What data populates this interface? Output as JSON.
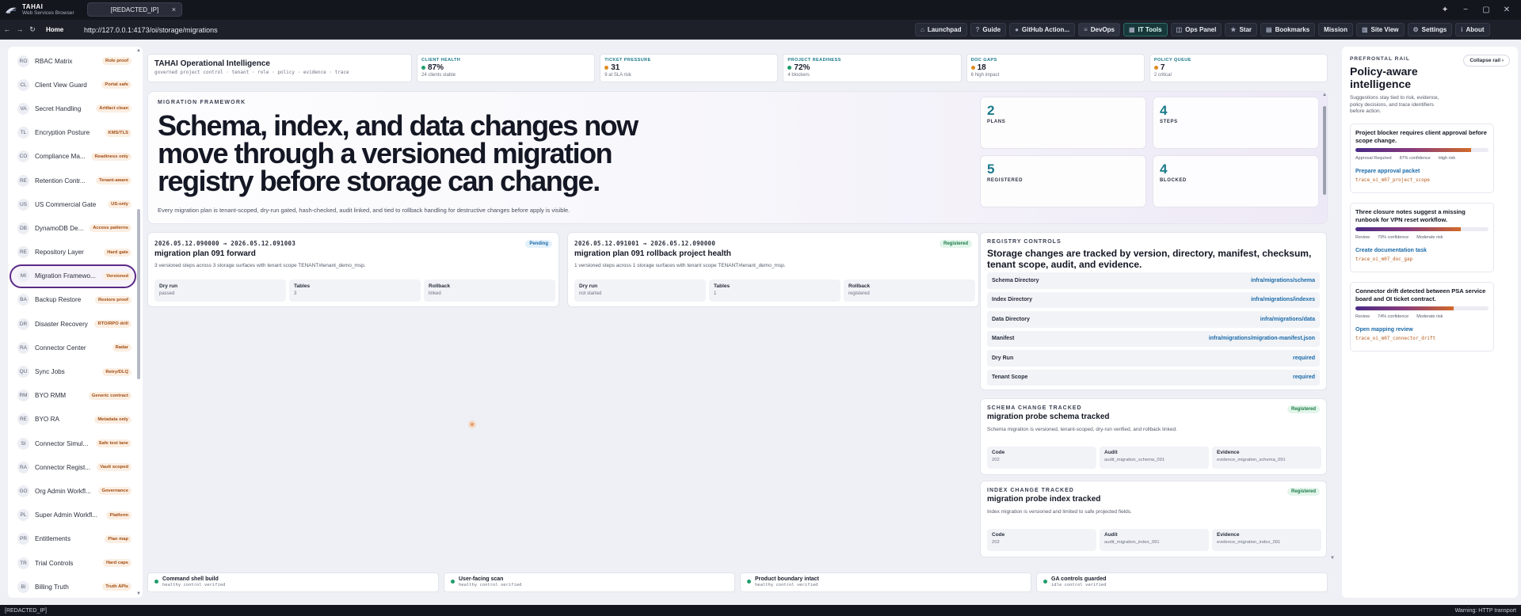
{
  "window": {
    "brand_name": "TAHAI",
    "brand_sub": "Web Services Browser",
    "tab_title": "[REDACTED_IP]",
    "tab_close": "×",
    "new_tab": "+",
    "minimize": "−",
    "maximize": "▢",
    "close": "✕"
  },
  "nav": {
    "back": "←",
    "forward": "→",
    "reload": "↻",
    "home": "Home",
    "url": "http://127.0.0.1:4173/oi/storage/migrations"
  },
  "toolbar": [
    {
      "icon": "⌂",
      "icon_name": "launchpad-icon",
      "label": "Launchpad"
    },
    {
      "icon": "?",
      "icon_name": "help-icon",
      "label": "Guide"
    },
    {
      "icon": "●",
      "icon_name": "github-icon",
      "label": "GitHub Action..."
    },
    {
      "icon": "≡",
      "icon_name": "devops-icon",
      "label": "DevOps"
    },
    {
      "icon": "▦",
      "icon_name": "tools-icon",
      "label": "IT Tools"
    },
    {
      "icon": "◫",
      "icon_name": "panel-icon",
      "label": "Ops Panel"
    },
    {
      "icon": "★",
      "icon_name": "star-icon",
      "label": "Star"
    },
    {
      "icon": "▤",
      "icon_name": "bookmark-icon",
      "label": "Bookmarks"
    },
    {
      "icon": "",
      "icon_name": "",
      "label": "Mission"
    },
    {
      "icon": "▥",
      "icon_name": "site-view-icon",
      "label": "Site View"
    },
    {
      "icon": "⚙",
      "icon_name": "gear-icon",
      "label": "Settings"
    },
    {
      "icon": "i",
      "icon_name": "info-icon",
      "label": "About"
    }
  ],
  "sidebar": {
    "items": [
      {
        "abbr": "RO",
        "label": "RBAC Matrix",
        "badge": "Role proof"
      },
      {
        "abbr": "CL",
        "label": "Client View Guard",
        "badge": "Portal safe"
      },
      {
        "abbr": "VA",
        "label": "Secret Handling",
        "badge": "Artifact clean"
      },
      {
        "abbr": "TL",
        "label": "Encryption Posture",
        "badge": "KMS/TLS"
      },
      {
        "abbr": "CO",
        "label": "Compliance Ma...",
        "badge": "Readiness only"
      },
      {
        "abbr": "RE",
        "label": "Retention Contr...",
        "badge": "Tenant-aware"
      },
      {
        "abbr": "US",
        "label": "US Commercial Gate",
        "badge": "US-only"
      },
      {
        "abbr": "DB",
        "label": "DynamoDB De...",
        "badge": "Access patterns"
      },
      {
        "abbr": "RE",
        "label": "Repository Layer",
        "badge": "Hard gate"
      },
      {
        "abbr": "MI",
        "label": "Migration Framewo...",
        "badge": "Versioned"
      },
      {
        "abbr": "BA",
        "label": "Backup Restore",
        "badge": "Restore proof"
      },
      {
        "abbr": "DR",
        "label": "Disaster Recovery",
        "badge": "RTO/RPO drill"
      },
      {
        "abbr": "RA",
        "label": "Connector Center",
        "badge": "Radar"
      },
      {
        "abbr": "QU",
        "label": "Sync Jobs",
        "badge": "Retry/DLQ"
      },
      {
        "abbr": "RM",
        "label": "BYO RMM",
        "badge": "Generic contract"
      },
      {
        "abbr": "RE",
        "label": "BYO RA",
        "badge": "Metadata only"
      },
      {
        "abbr": "SI",
        "label": "Connector Simul...",
        "badge": "Safe test lane"
      },
      {
        "abbr": "RA",
        "label": "Connector Regist...",
        "badge": "Vault scoped"
      },
      {
        "abbr": "GO",
        "label": "Org Admin Workfl...",
        "badge": "Governance"
      },
      {
        "abbr": "PL",
        "label": "Super Admin Workfl...",
        "badge": "Platform"
      },
      {
        "abbr": "PR",
        "label": "Entitlements",
        "badge": "Plan map"
      },
      {
        "abbr": "TR",
        "label": "Trial Controls",
        "badge": "Hard caps"
      },
      {
        "abbr": "BI",
        "label": "Billing Truth",
        "badge": "Truth APIs"
      }
    ]
  },
  "stats": {
    "title": "TAHAI Operational Intelligence",
    "subtitle": "governed project control · tenant · role · policy · evidence · trace",
    "cards": [
      {
        "label": "CLIENT HEALTH",
        "value": "87%",
        "note": "24 clients stable",
        "color": "#1f9d6b"
      },
      {
        "label": "TICKET PRESSURE",
        "value": "31",
        "note": "9 at SLA risk",
        "color": "#e08a1e"
      },
      {
        "label": "PROJECT READINESS",
        "value": "72%",
        "note": "4 blockers",
        "color": "#1f9d6b"
      },
      {
        "label": "DOC GAPS",
        "value": "18",
        "note": "6 high impact",
        "color": "#e08a1e"
      },
      {
        "label": "POLICY QUEUE",
        "value": "7",
        "note": "2 critical",
        "color": "#e08a1e"
      }
    ]
  },
  "hero": {
    "kicker": "MIGRATION FRAMEWORK",
    "headline": "Schema, index, and data changes now move through a versioned migration registry before storage can change.",
    "description": "Every migration plan is tenant-scoped, dry-run gated, hash-checked, audit linked, and tied to rollback handling for destructive changes before apply is visible.",
    "metrics": [
      {
        "value": "2",
        "label": "PLANS"
      },
      {
        "value": "4",
        "label": "STEPS"
      },
      {
        "value": "5",
        "label": "REGISTERED"
      },
      {
        "value": "4",
        "label": "BLOCKED"
      }
    ]
  },
  "plans": [
    {
      "range": "2026.05.12.090000 → 2026.05.12.091003",
      "title": "migration plan 091 forward",
      "description": "3 versioned steps across 3 storage surfaces with tenant scope TENANT#tenant_demo_msp.",
      "badge": "Pending",
      "cells": [
        {
          "label": "Dry run",
          "value": "passed"
        },
        {
          "label": "Tables",
          "value": "3"
        },
        {
          "label": "Rollback",
          "value": "linked"
        }
      ]
    },
    {
      "range": "2026.05.12.091001 → 2026.05.12.090000",
      "title": "migration plan 091 rollback project health",
      "description": "1 versioned steps across 1 storage surfaces with tenant scope TENANT#tenant_demo_msp.",
      "badge": "Registered",
      "cells": [
        {
          "label": "Dry run",
          "value": "not started"
        },
        {
          "label": "Tables",
          "value": "1"
        },
        {
          "label": "Rollback",
          "value": "registered"
        }
      ]
    }
  ],
  "registry": {
    "kicker": "REGISTRY CONTROLS",
    "title": "Storage changes are tracked by version, directory, manifest, checksum, tenant scope, audit, and evidence.",
    "rows": [
      {
        "key": "Schema Directory",
        "value": "infra/migrations/schema"
      },
      {
        "key": "Index Directory",
        "value": "infra/migrations/indexes"
      },
      {
        "key": "Data Directory",
        "value": "infra/migrations/data"
      },
      {
        "key": "Manifest",
        "value": "infra/migrations/migration-manifest.json"
      },
      {
        "key": "Dry Run",
        "value": "required"
      },
      {
        "key": "Tenant Scope",
        "value": "required"
      }
    ]
  },
  "changes": [
    {
      "kicker": "SCHEMA CHANGE TRACKED",
      "title": "migration probe schema tracked",
      "description": "Schema migration is versioned, tenant-scoped, dry-run verified, and rollback linked.",
      "badge": "Registered",
      "cells": [
        {
          "label": "Code",
          "value": "202"
        },
        {
          "label": "Audit",
          "value": "audit_migration_schema_091"
        },
        {
          "label": "Evidence",
          "value": "evidence_migration_schema_091"
        }
      ]
    },
    {
      "kicker": "INDEX CHANGE TRACKED",
      "title": "migration probe index tracked",
      "description": "Index migration is versioned and limited to safe projected fields.",
      "badge": "Registered",
      "cells": [
        {
          "label": "Code",
          "value": "202"
        },
        {
          "label": "Audit",
          "value": "audit_migration_index_091"
        },
        {
          "label": "Evidence",
          "value": "evidence_migration_index_091"
        }
      ]
    }
  ],
  "bottom": [
    {
      "title": "Command shell build",
      "sub": "healthy control verified"
    },
    {
      "title": "User-facing scan",
      "sub": "healthy control verified"
    },
    {
      "title": "Product boundary intact",
      "sub": "healthy control verified"
    },
    {
      "title": "GA controls guarded",
      "sub": "idle control verified"
    }
  ],
  "rail": {
    "kicker": "PREFRONTAL RAIL",
    "title": "Policy-aware intelligence",
    "description": "Suggestions stay tied to risk, evidence, policy decisions, and trace identifiers before action.",
    "collapse": "Collapse rail",
    "insights": [
      {
        "title": "Project blocker requires client approval before scope change.",
        "progress": 0.87,
        "tags": [
          "Approval Required",
          "87% confidence",
          "High risk"
        ],
        "action": "Prepare approval packet",
        "trace": "trace_oi_m07_project_scope"
      },
      {
        "title": "Three closure notes suggest a missing runbook for VPN reset workflow.",
        "progress": 0.79,
        "tags": [
          "Review",
          "79% confidence",
          "Moderate risk"
        ],
        "action": "Create documentation task",
        "trace": "trace_oi_m07_doc_gap"
      },
      {
        "title": "Connector drift detected between PSA service board and OI ticket contract.",
        "progress": 0.74,
        "tags": [
          "Review",
          "74% confidence",
          "Moderate risk"
        ],
        "action": "Open mapping review",
        "trace": "trace_oi_m07_connector_drift"
      }
    ]
  },
  "status": {
    "left": "[REDACTED_IP]",
    "right": "Warning: HTTP transport"
  }
}
